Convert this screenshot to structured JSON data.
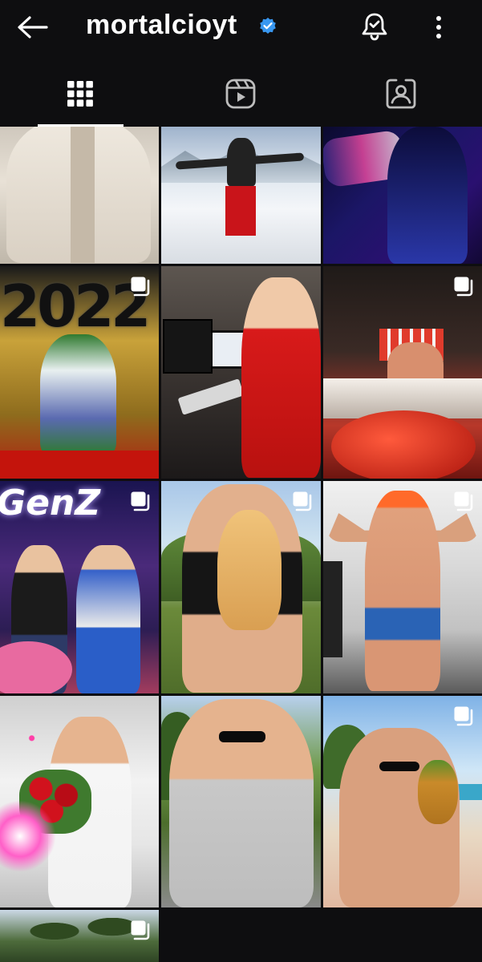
{
  "header": {
    "username": "mortalcioyt",
    "back_icon": "arrow-left-icon",
    "verified_icon": "verified-badge-icon",
    "notifications_icon": "bell-check-icon",
    "more_icon": "more-vertical-icon"
  },
  "tabs": [
    {
      "name": "posts",
      "icon": "grid-icon",
      "selected": true
    },
    {
      "name": "reels",
      "icon": "reels-icon",
      "selected": false
    },
    {
      "name": "tagged",
      "icon": "tagged-person-icon",
      "selected": false
    }
  ],
  "posts": [
    {
      "id": 1,
      "multi": false
    },
    {
      "id": 2,
      "multi": false
    },
    {
      "id": 3,
      "multi": false
    },
    {
      "id": 4,
      "multi": true
    },
    {
      "id": 5,
      "multi": false
    },
    {
      "id": 6,
      "multi": true
    },
    {
      "id": 7,
      "multi": true
    },
    {
      "id": 8,
      "multi": true
    },
    {
      "id": 9,
      "multi": true
    },
    {
      "id": 10,
      "multi": false
    },
    {
      "id": 11,
      "multi": false
    },
    {
      "id": 12,
      "multi": true
    },
    {
      "id": 13,
      "multi": true
    }
  ],
  "colors": {
    "background": "#0e0e10",
    "verified": "#3897f0",
    "icon": "#ffffff",
    "tab_inactive": "#bdbdbd"
  },
  "posts_text": {
    "banner_2022": "2022",
    "sign_genz": "GenZ"
  }
}
